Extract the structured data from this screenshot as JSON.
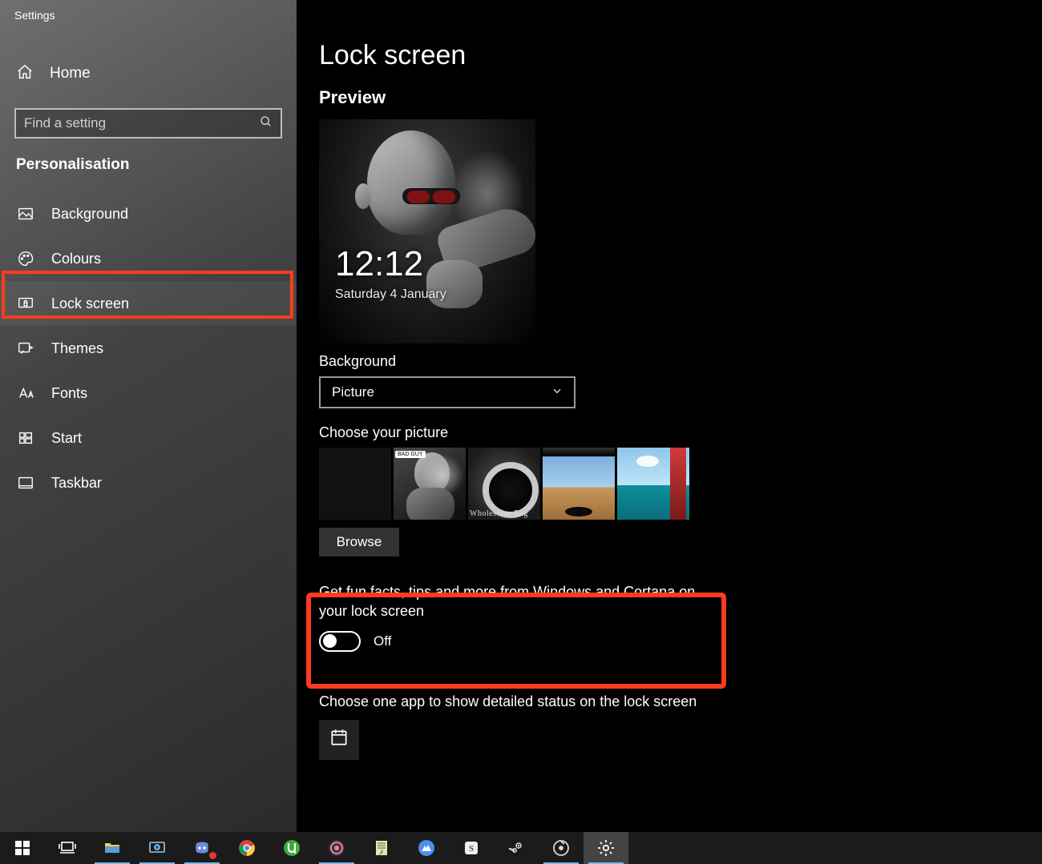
{
  "window": {
    "title": "Settings"
  },
  "sidebar": {
    "home_label": "Home",
    "search_placeholder": "Find a setting",
    "category_label": "Personalisation",
    "items": [
      {
        "label": "Background",
        "icon": "background-icon"
      },
      {
        "label": "Colours",
        "icon": "colours-icon"
      },
      {
        "label": "Lock screen",
        "icon": "lock-screen-icon",
        "active": true
      },
      {
        "label": "Themes",
        "icon": "themes-icon"
      },
      {
        "label": "Fonts",
        "icon": "fonts-icon"
      },
      {
        "label": "Start",
        "icon": "start-icon"
      },
      {
        "label": "Taskbar",
        "icon": "taskbar-icon"
      }
    ]
  },
  "page": {
    "title": "Lock screen",
    "preview_label": "Preview",
    "preview_time": "12:12",
    "preview_date": "Saturday 4 January",
    "background_label": "Background",
    "background_selected": "Picture",
    "choose_picture_label": "Choose your picture",
    "thumbnail_caption_2": "Wholesome Rag",
    "thumbnail_bubble_1": "BAD GUY",
    "browse_label": "Browse",
    "fun_facts_label": "Get fun facts, tips and more from Windows and Cortana on your lock screen",
    "fun_facts_state": "Off",
    "detailed_status_label": "Choose one app to show detailed status on the lock screen"
  },
  "taskbar": {
    "items": [
      "start-button",
      "task-view-button",
      "file-explorer-icon",
      "teamviewer-icon",
      "discord-icon",
      "chrome-icon",
      "utorrent-icon",
      "voicemeeter-icon",
      "notepadpp-icon",
      "nordvpn-icon",
      "sai-icon",
      "steam-icon",
      "groove-icon",
      "settings-icon"
    ],
    "active_index": 13
  }
}
